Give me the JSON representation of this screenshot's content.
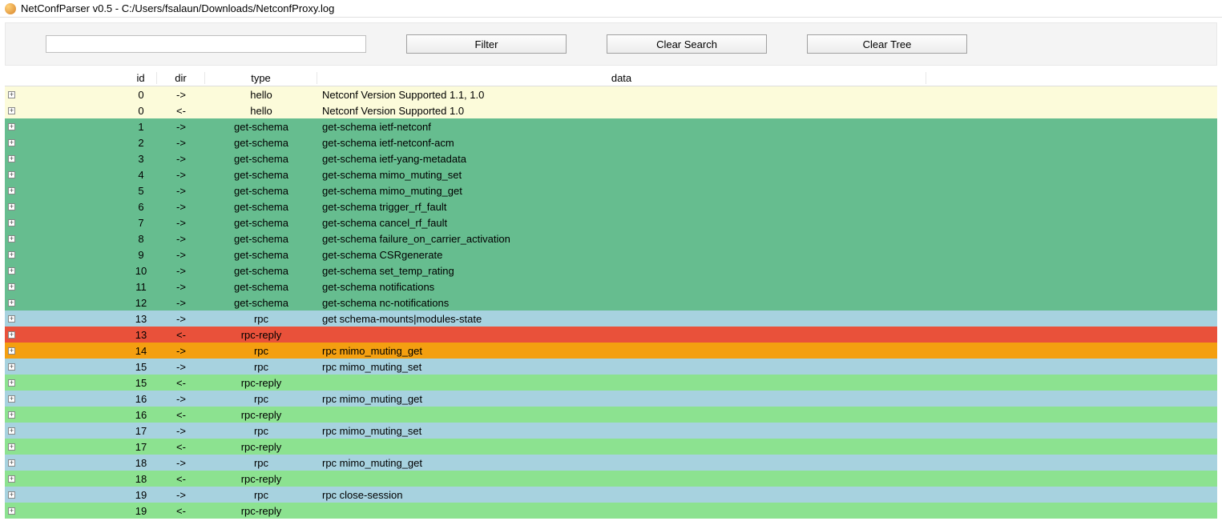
{
  "window": {
    "title": "NetConfParser v0.5 - C:/Users/fsalaun/Downloads/NetconfProxy.log"
  },
  "toolbar": {
    "search_value": "",
    "search_placeholder": "",
    "filter_label": "Filter",
    "clear_search_label": "Clear Search",
    "clear_tree_label": "Clear Tree"
  },
  "columns": {
    "c0": "",
    "id": "id",
    "dir": "dir",
    "type": "type",
    "data": "data",
    "c5": ""
  },
  "rows": [
    {
      "id": "0",
      "dir": "->",
      "type": "hello",
      "data": "Netconf Version Supported 1.1, 1.0",
      "cls": "c-hello"
    },
    {
      "id": "0",
      "dir": "<-",
      "type": "hello",
      "data": "Netconf Version Supported 1.0",
      "cls": "c-hello"
    },
    {
      "id": "1",
      "dir": "->",
      "type": "get-schema",
      "data": "get-schema ietf-netconf",
      "cls": "c-green"
    },
    {
      "id": "2",
      "dir": "->",
      "type": "get-schema",
      "data": "get-schema ietf-netconf-acm",
      "cls": "c-green"
    },
    {
      "id": "3",
      "dir": "->",
      "type": "get-schema",
      "data": "get-schema ietf-yang-metadata",
      "cls": "c-green"
    },
    {
      "id": "4",
      "dir": "->",
      "type": "get-schema",
      "data": "get-schema mimo_muting_set",
      "cls": "c-green"
    },
    {
      "id": "5",
      "dir": "->",
      "type": "get-schema",
      "data": "get-schema mimo_muting_get",
      "cls": "c-green"
    },
    {
      "id": "6",
      "dir": "->",
      "type": "get-schema",
      "data": "get-schema trigger_rf_fault",
      "cls": "c-green"
    },
    {
      "id": "7",
      "dir": "->",
      "type": "get-schema",
      "data": "get-schema cancel_rf_fault",
      "cls": "c-green"
    },
    {
      "id": "8",
      "dir": "->",
      "type": "get-schema",
      "data": "get-schema failure_on_carrier_activation",
      "cls": "c-green"
    },
    {
      "id": "9",
      "dir": "->",
      "type": "get-schema",
      "data": "get-schema CSRgenerate",
      "cls": "c-green"
    },
    {
      "id": "10",
      "dir": "->",
      "type": "get-schema",
      "data": "get-schema set_temp_rating",
      "cls": "c-green"
    },
    {
      "id": "11",
      "dir": "->",
      "type": "get-schema",
      "data": "get-schema notifications",
      "cls": "c-green"
    },
    {
      "id": "12",
      "dir": "->",
      "type": "get-schema",
      "data": "get-schema nc-notifications",
      "cls": "c-green"
    },
    {
      "id": "13",
      "dir": "->",
      "type": "rpc",
      "data": "get schema-mounts|modules-state",
      "cls": "c-lblue"
    },
    {
      "id": "13",
      "dir": "<-",
      "type": "rpc-reply",
      "data": "",
      "cls": "c-red"
    },
    {
      "id": "14",
      "dir": "->",
      "type": "rpc",
      "data": "rpc mimo_muting_get",
      "cls": "c-orange"
    },
    {
      "id": "15",
      "dir": "->",
      "type": "rpc",
      "data": "rpc mimo_muting_set",
      "cls": "c-lblue"
    },
    {
      "id": "15",
      "dir": "<-",
      "type": "rpc-reply",
      "data": "",
      "cls": "c-lgreen"
    },
    {
      "id": "16",
      "dir": "->",
      "type": "rpc",
      "data": "rpc mimo_muting_get",
      "cls": "c-lblue"
    },
    {
      "id": "16",
      "dir": "<-",
      "type": "rpc-reply",
      "data": "",
      "cls": "c-lgreen"
    },
    {
      "id": "17",
      "dir": "->",
      "type": "rpc",
      "data": "rpc mimo_muting_set",
      "cls": "c-lblue"
    },
    {
      "id": "17",
      "dir": "<-",
      "type": "rpc-reply",
      "data": "",
      "cls": "c-lgreen"
    },
    {
      "id": "18",
      "dir": "->",
      "type": "rpc",
      "data": "rpc mimo_muting_get",
      "cls": "c-lblue"
    },
    {
      "id": "18",
      "dir": "<-",
      "type": "rpc-reply",
      "data": "",
      "cls": "c-lgreen"
    },
    {
      "id": "19",
      "dir": "->",
      "type": "rpc",
      "data": "rpc close-session",
      "cls": "c-lblue"
    },
    {
      "id": "19",
      "dir": "<-",
      "type": "rpc-reply",
      "data": "",
      "cls": "c-lgreen"
    }
  ]
}
